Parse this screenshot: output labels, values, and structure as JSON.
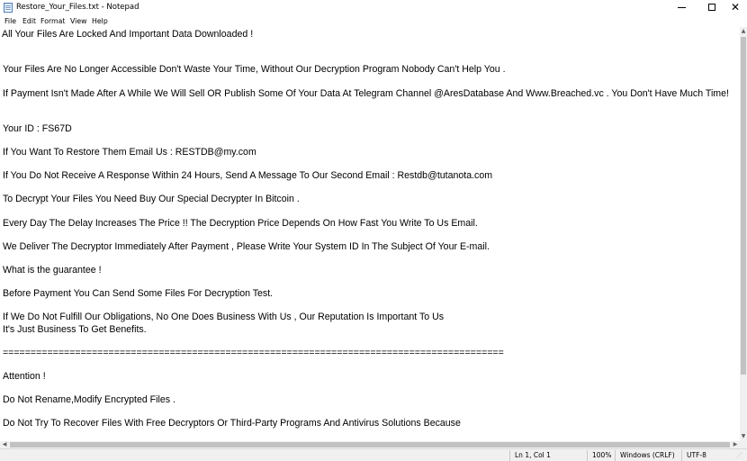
{
  "window": {
    "title": "Restore_Your_Files.txt - Notepad",
    "minimize_glyph": "",
    "maximize_glyph": "",
    "close_glyph": "✕"
  },
  "menu": {
    "file": "File",
    "edit": "Edit",
    "format": "Format",
    "view": "View",
    "help": "Help"
  },
  "document": {
    "lines": [
      "All Your Files Are Locked And Important Data Downloaded !",
      "",
      "",
      "Your Files Are No Longer Accessible Don't Waste Your Time, Without Our Decryption Program Nobody Can't Help You .",
      "",
      "If Payment Isn't Made After A While We Will Sell OR Publish Some Of Your Data At Telegram Channel @AresDatabase And Www.Breached.vc . You Don't Have Much Time!",
      "",
      "",
      "Your ID : FS67D",
      "",
      "If You Want To Restore Them Email Us : RESTDB@my.com",
      "",
      "If You Do Not Receive A Response Within 24 Hours, Send A Message To Our Second Email : Restdb@tutanota.com",
      "",
      "To Decrypt Your Files You Need Buy Our Special Decrypter In Bitcoin .",
      "",
      "Every Day The Delay Increases The Price !! The Decryption Price Depends On How Fast You Write To Us Email.",
      "",
      "We Deliver The Decryptor Immediately After Payment , Please Write Your System ID In The Subject Of Your E-mail.",
      "",
      "What is the guarantee !",
      "",
      "Before Payment You Can Send Some Files For Decryption Test.",
      "",
      "If We Do Not Fulfill Our Obligations, No One Does Business With Us , Our Reputation Is Important To Us",
      "It's Just Business To Get Benefits.",
      "",
      "==========================================================================================",
      "",
      "Attention !",
      "",
      "Do Not Rename,Modify Encrypted Files .",
      "",
      "Do Not Try To Recover Files With Free Decryptors Or Third-Party Programs And Antivirus Solutions Because"
    ]
  },
  "statusbar": {
    "position": "Ln 1, Col 1",
    "zoom": "100%",
    "line_ending": "Windows (CRLF)",
    "encoding": "UTF-8"
  },
  "icons": {
    "app": "notepad-icon",
    "scroll_up": "▲",
    "scroll_down": "▼",
    "scroll_left": "◀",
    "scroll_right": "▶",
    "grip": "⋰"
  }
}
